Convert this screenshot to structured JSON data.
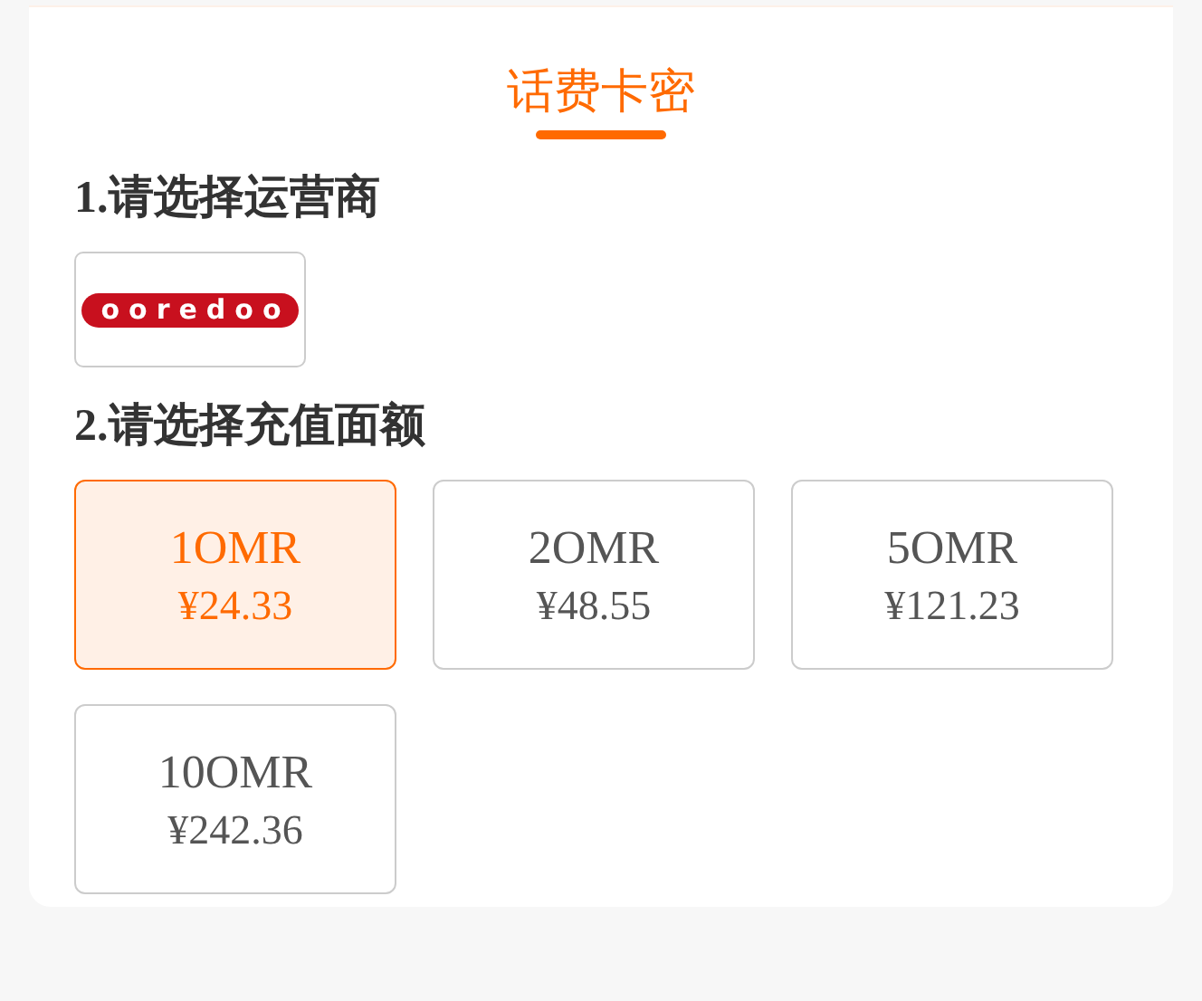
{
  "tab": {
    "label": "话费卡密",
    "selected": true
  },
  "sections": [
    {
      "heading": "1.请选择运营商"
    },
    {
      "heading": "2.请选择充值面额"
    }
  ],
  "operators": [
    {
      "logo": "ooredoo",
      "selected": false
    }
  ],
  "amounts": [
    {
      "amount": "1OMR",
      "price": "¥24.33",
      "selected": true
    },
    {
      "amount": "2OMR",
      "price": "¥48.55",
      "selected": false
    },
    {
      "amount": "5OMR",
      "price": "¥121.23",
      "selected": false
    },
    {
      "amount": "10OMR",
      "price": "¥242.36",
      "selected": false
    }
  ]
}
